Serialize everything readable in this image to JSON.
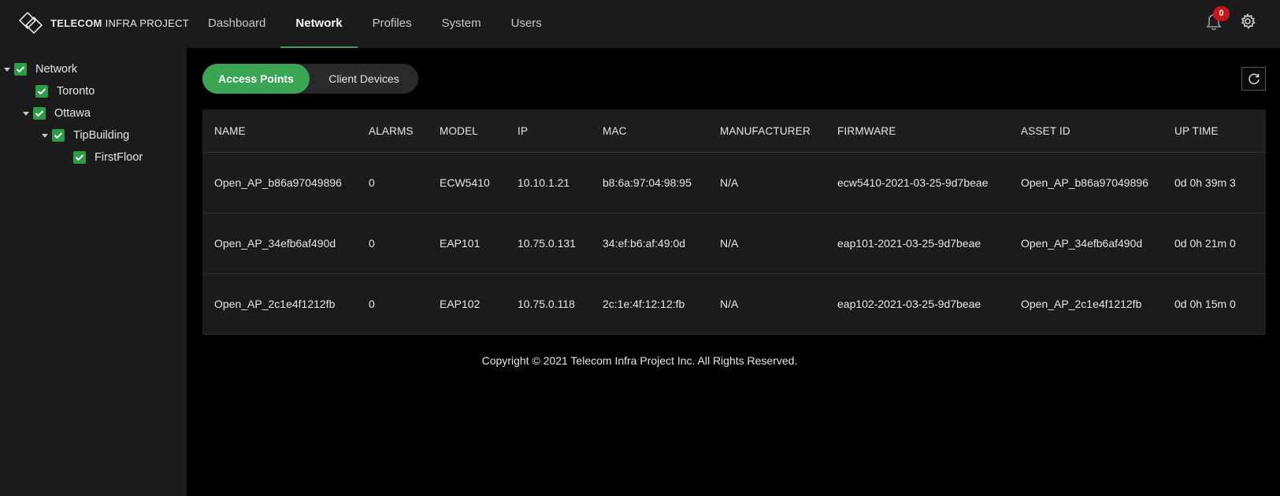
{
  "header": {
    "logo": {
      "brand_bold": "TELECOM",
      "brand_rest": " INFRA PROJECT"
    },
    "nav": [
      {
        "label": "Dashboard",
        "active": false
      },
      {
        "label": "Network",
        "active": true
      },
      {
        "label": "Profiles",
        "active": false
      },
      {
        "label": "System",
        "active": false
      },
      {
        "label": "Users",
        "active": false
      }
    ],
    "notifications": {
      "icon": "bell-icon",
      "count": "0"
    },
    "settings": {
      "icon": "gear-icon"
    }
  },
  "sidebar": {
    "tree": [
      {
        "label": "Network",
        "expanded": true,
        "checked": true
      },
      {
        "label": "Toronto",
        "expanded": false,
        "checked": true
      },
      {
        "label": "Ottawa",
        "expanded": true,
        "checked": true
      },
      {
        "label": "TipBuilding",
        "expanded": true,
        "checked": true
      },
      {
        "label": "FirstFloor",
        "expanded": false,
        "checked": true
      }
    ]
  },
  "main": {
    "toggle": {
      "active": "Access Points",
      "inactive": "Client Devices"
    },
    "refresh": {
      "icon": "refresh-icon"
    },
    "table": {
      "columns": [
        "NAME",
        "ALARMS",
        "MODEL",
        "IP",
        "MAC",
        "MANUFACTURER",
        "FIRMWARE",
        "ASSET ID",
        "UP TIME"
      ],
      "rows": [
        [
          "Open_AP_b86a97049896",
          "0",
          "ECW5410",
          "10.10.1.21",
          "b8:6a:97:04:98:95",
          "N/A",
          "ecw5410-2021-03-25-9d7beae",
          "Open_AP_b86a97049896",
          "0d 0h 39m 3"
        ],
        [
          "Open_AP_34efb6af490d",
          "0",
          "EAP101",
          "10.75.0.131",
          "34:ef:b6:af:49:0d",
          "N/A",
          "eap101-2021-03-25-9d7beae",
          "Open_AP_34efb6af490d",
          "0d 0h 21m 0"
        ],
        [
          "Open_AP_2c1e4f1212fb",
          "0",
          "EAP102",
          "10.75.0.118",
          "2c:1e:4f:12:12:fb",
          "N/A",
          "eap102-2021-03-25-9d7beae",
          "Open_AP_2c1e4f1212fb",
          "0d 0h 15m 0"
        ]
      ]
    },
    "footer": "Copyright © 2021 Telecom Infra Project Inc. All Rights Reserved."
  },
  "colors": {
    "accent": "#3aa655",
    "badge": "#c3171d",
    "panel": "#1b1b1b",
    "background": "#000000"
  }
}
